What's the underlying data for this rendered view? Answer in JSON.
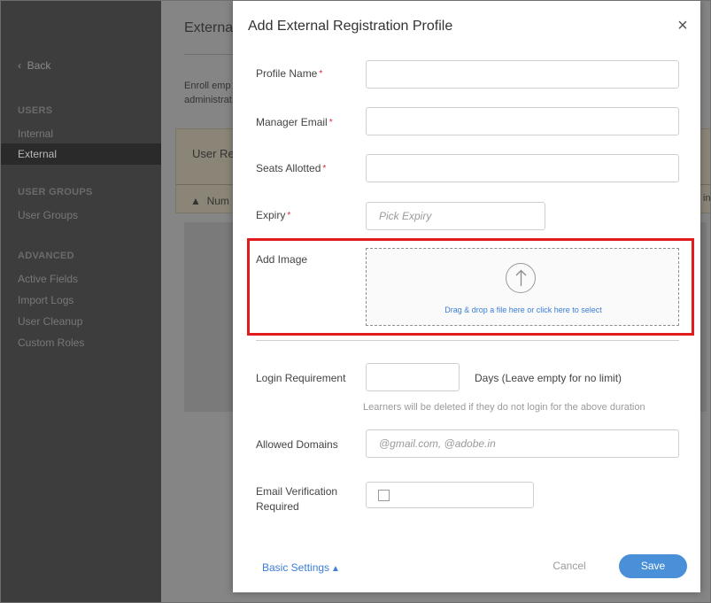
{
  "sidebar": {
    "back_label": "Back",
    "sections": [
      {
        "title": "USERS",
        "items": [
          "Internal",
          "External"
        ]
      },
      {
        "title": "USER GROUPS",
        "items": [
          "User Groups"
        ]
      },
      {
        "title": "ADVANCED",
        "items": [
          "Active Fields",
          "Import Logs",
          "User Cleanup",
          "Custom Roles"
        ]
      }
    ],
    "active_item": "External"
  },
  "background": {
    "page_title": "Externa",
    "description_line1": "Enroll emp",
    "description_line2": "administrat",
    "right_fragment_1": "n",
    "box_title": "User Reg",
    "warning_text": "Num",
    "right_fragment_2": "in"
  },
  "modal": {
    "title": "Add External Registration Profile",
    "close_label": "×",
    "fields": {
      "profile_name": {
        "label": "Profile Name",
        "value": "",
        "placeholder": ""
      },
      "manager_email": {
        "label": "Manager Email",
        "value": "",
        "placeholder": ""
      },
      "seats_allotted": {
        "label": "Seats Allotted",
        "value": "",
        "placeholder": ""
      },
      "expiry": {
        "label": "Expiry",
        "value": "",
        "placeholder": "Pick Expiry"
      },
      "add_image": {
        "label": "Add Image",
        "drop_text": "Drag & drop a file here or click here to select"
      },
      "login_requirement": {
        "label": "Login Requirement",
        "value": "",
        "suffix": "Days (Leave empty for no limit)",
        "helper": "Learners will be deleted if they do not login for the above duration"
      },
      "allowed_domains": {
        "label": "Allowed Domains",
        "value": "",
        "placeholder": "@gmail.com, @adobe.in"
      },
      "email_verification": {
        "label_line1": "Email Verification",
        "label_line2": "Required",
        "checked": false
      }
    },
    "required_marker": "*",
    "footer": {
      "basic_settings_label": "Basic Settings",
      "cancel_label": "Cancel",
      "save_label": "Save"
    }
  },
  "colors": {
    "highlight_border": "#e01b1b",
    "save_button": "#4a90d9",
    "link": "#3b7dd8",
    "required": "#d7263d"
  }
}
